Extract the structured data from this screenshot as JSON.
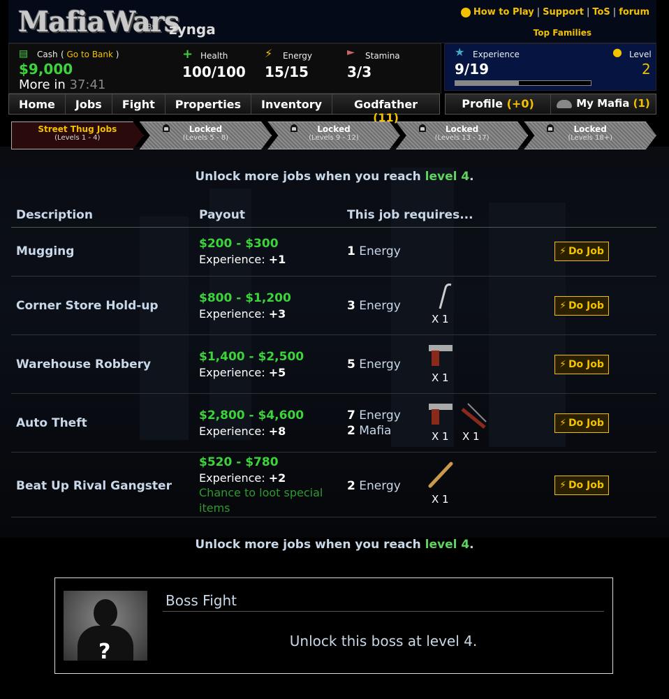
{
  "header": {
    "logo": "MafiaWars",
    "by": "By",
    "brand": "zynga",
    "links": [
      "How to Play",
      "Support",
      "ToS",
      "forum"
    ],
    "top_families": "Top Families"
  },
  "stats": {
    "cash_label": "Cash",
    "bank_link": "Go to Bank",
    "cash_value": "$9,000",
    "more_in_label": "More in",
    "more_in_time": "37:41",
    "health_label": "Health",
    "health_value": "100/100",
    "energy_label": "Energy",
    "energy_value": "15/15",
    "stamina_label": "Stamina",
    "stamina_value": "3/3",
    "experience_label": "Experience",
    "experience_value": "9/19",
    "experience_progress": 0.47,
    "level_label": "Level",
    "level_value": "2"
  },
  "nav": {
    "items": [
      "Home",
      "Jobs",
      "Fight",
      "Properties",
      "Inventory"
    ],
    "godfather_label": "Godfather",
    "godfather_count": "(11)",
    "profile_label": "Profile",
    "profile_count": "(+0)",
    "mymafia_label": "My Mafia",
    "mymafia_count": "(1)"
  },
  "tiers": [
    {
      "title": "Street Thug Jobs",
      "levels": "(Levels 1 - 4)"
    },
    {
      "title": "Locked",
      "levels": "(Levels 5 - 8)"
    },
    {
      "title": "Locked",
      "levels": "(Levels 9 - 12)"
    },
    {
      "title": "Locked",
      "levels": "(Levels 13 - 17)"
    },
    {
      "title": "Locked",
      "levels": "(Levels 18+)"
    }
  ],
  "unlock": {
    "text": "Unlock more jobs when you reach",
    "level": "level 4",
    "period": "."
  },
  "table": {
    "headers": [
      "Description",
      "Payout",
      "This job requires..."
    ],
    "experience_label": "Experience:",
    "energy_unit": "Energy",
    "mafia_unit": "Mafia",
    "do_job": "Do Job",
    "rows": [
      {
        "name": "Mugging",
        "payout": "$200 - $300",
        "exp": "+1",
        "energy": "1"
      },
      {
        "name": "Corner Store Hold-up",
        "payout": "$800 - $1,200",
        "exp": "+3",
        "energy": "3",
        "qty1": "X 1"
      },
      {
        "name": "Warehouse Robbery",
        "payout": "$1,400 - $2,500",
        "exp": "+5",
        "energy": "5",
        "qty1": "X 1"
      },
      {
        "name": "Auto Theft",
        "payout": "$2,800 - $4,600",
        "exp": "+8",
        "energy": "7",
        "mafia": "2",
        "qty1": "X 1",
        "qty2": "X 1"
      },
      {
        "name": "Beat Up Rival Gangster",
        "payout": "$520 - $780",
        "exp": "+2",
        "energy": "2",
        "loot": "Chance to loot special items",
        "qty1": "X 1"
      }
    ]
  },
  "boss": {
    "title": "Boss Fight",
    "message": "Unlock this boss at level 4.",
    "placeholder": "?"
  }
}
